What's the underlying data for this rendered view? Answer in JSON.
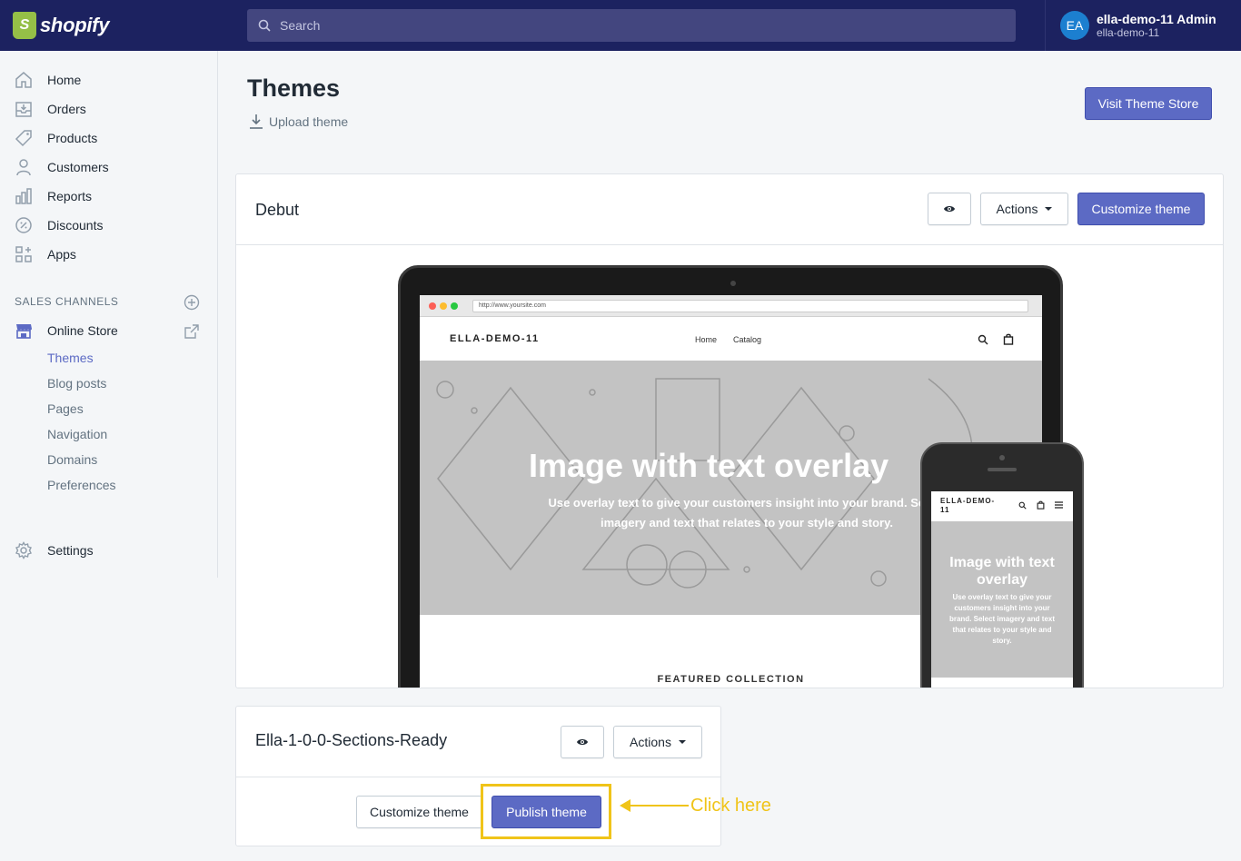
{
  "brand": {
    "name": "shopify"
  },
  "search": {
    "placeholder": "Search"
  },
  "user": {
    "initials": "EA",
    "name": "ella-demo-11 Admin",
    "store": "ella-demo-11"
  },
  "sidebar": {
    "items": [
      {
        "label": "Home",
        "icon": "home-icon"
      },
      {
        "label": "Orders",
        "icon": "orders-icon"
      },
      {
        "label": "Products",
        "icon": "tag-icon"
      },
      {
        "label": "Customers",
        "icon": "person-icon"
      },
      {
        "label": "Reports",
        "icon": "bar-chart-icon"
      },
      {
        "label": "Discounts",
        "icon": "discount-icon"
      },
      {
        "label": "Apps",
        "icon": "apps-icon"
      }
    ],
    "sales_channels_label": "SALES CHANNELS",
    "online_store": "Online Store",
    "sub_items": [
      "Themes",
      "Blog posts",
      "Pages",
      "Navigation",
      "Domains",
      "Preferences"
    ],
    "settings": "Settings"
  },
  "page": {
    "title": "Themes",
    "upload_label": "Upload theme",
    "visit_store_label": "Visit Theme Store"
  },
  "current_theme": {
    "name": "Debut",
    "actions_label": "Actions",
    "customize_label": "Customize theme",
    "preview": {
      "url": "http://www.yoursite.com",
      "site_name": "ELLA-DEMO-11",
      "nav": [
        "Home",
        "Catalog"
      ],
      "hero_title": "Image with text overlay",
      "hero_sub": "Use overlay text to give your customers insight into your brand. Select imagery and text that relates to your style and story.",
      "featured": "FEATURED COLLECTION",
      "phone_site_name": "ELLA-DEMO-11",
      "phone_hero_title": "Image with text overlay",
      "phone_hero_sub": "Use overlay text to give your customers insight into your brand. Select imagery and text that relates to your style and story."
    }
  },
  "other_theme": {
    "name": "Ella-1-0-0-Sections-Ready",
    "actions_label": "Actions",
    "customize_label": "Customize theme",
    "publish_label": "Publish theme"
  },
  "annotation": {
    "text": "Click here",
    "color": "#f0c419"
  },
  "colors": {
    "topbar": "#1c2260",
    "primary": "#5c6ac4",
    "active_nav": "#5c6ac4"
  }
}
